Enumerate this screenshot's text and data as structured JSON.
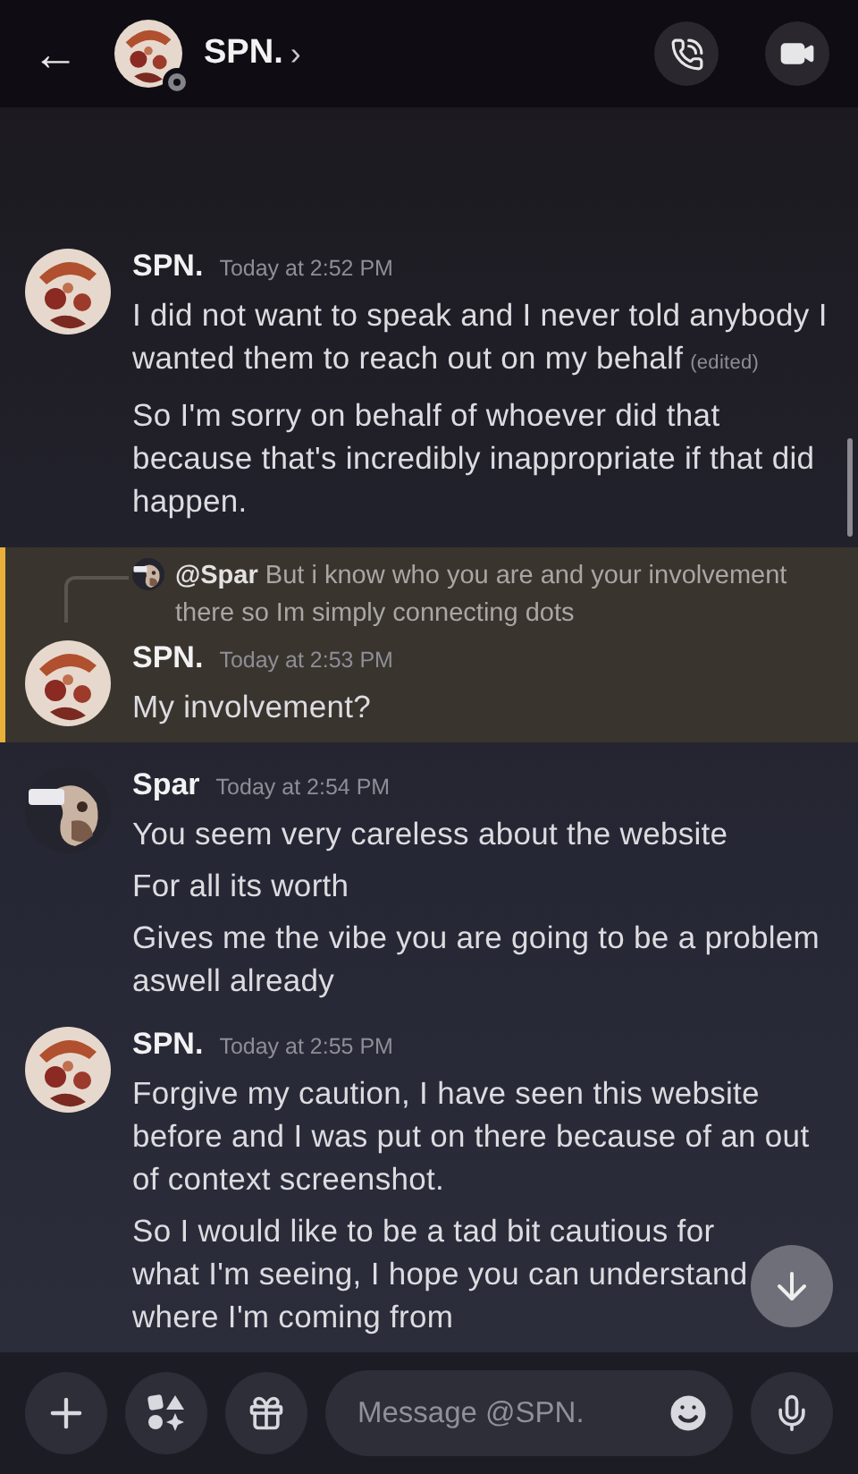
{
  "header": {
    "back": "←",
    "name": "SPN.",
    "chevron": "›",
    "status": {
      "kind": "offline"
    }
  },
  "messages": [
    {
      "author": "SPN.",
      "avatar": {
        "kind": "spn"
      },
      "time": "Today at 2:52 PM",
      "highlighted": false,
      "paragraphs": [
        {
          "text": "I did not want to speak and I never told anybody I wanted them to reach out on my behalf",
          "edited": "(edited)"
        },
        {
          "text": "So I'm sorry on behalf of whoever did that because that's incredibly inappropriate if that did happen."
        }
      ]
    },
    {
      "author": "SPN.",
      "avatar": {
        "kind": "spn"
      },
      "time": "Today at 2:53 PM",
      "highlighted": true,
      "reply": {
        "mention": "@Spar",
        "text": "But i know who you are and your involvement there so Im simply connecting dots"
      },
      "paragraphs": [
        {
          "text": "My involvement?"
        }
      ]
    },
    {
      "author": "Spar",
      "avatar": {
        "kind": "spar"
      },
      "time": "Today at 2:54 PM",
      "highlighted": false,
      "paragraphs": [
        {
          "text": "You seem very careless about the website"
        },
        {
          "text": "For all its worth"
        },
        {
          "text": "Gives me the vibe you are going to be a problem aswell already"
        }
      ]
    },
    {
      "author": "SPN.",
      "avatar": {
        "kind": "spn"
      },
      "time": "Today at 2:55 PM",
      "highlighted": false,
      "paragraphs": [
        {
          "text": "Forgive my caution, I have seen this website before and I was put on there because of an out of context screenshot."
        },
        {
          "text": "So I would like to be a tad bit cautious for what I'm seeing, I hope you can understand where I'm coming from"
        }
      ]
    }
  ],
  "composer": {
    "placeholder": "Message @SPN."
  }
}
